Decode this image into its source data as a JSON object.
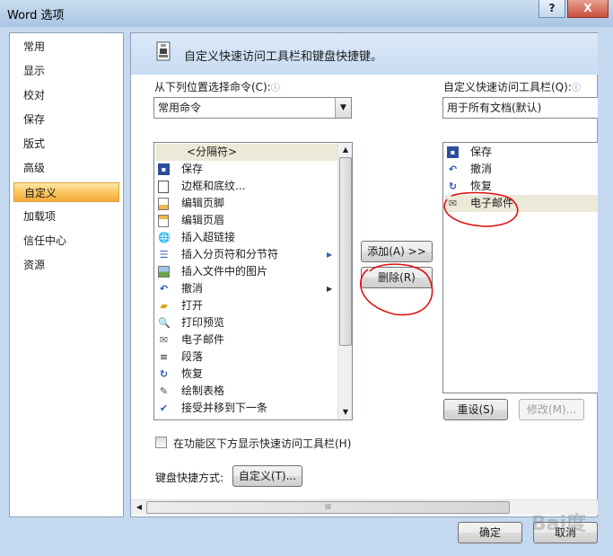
{
  "window": {
    "title": "Word 选项",
    "help_button": "?",
    "close_button": "X"
  },
  "nav": {
    "items": [
      "常用",
      "显示",
      "校对",
      "保存",
      "版式",
      "高级",
      "自定义",
      "加载项",
      "信任中心",
      "资源"
    ],
    "selected": "自定义"
  },
  "header": {
    "title": "自定义快速访问工具栏和键盘快捷键。"
  },
  "left_pane": {
    "label": "从下列位置选择命令(C):",
    "info_icon": "ⓘ",
    "combo_value": "常用命令",
    "commands": [
      {
        "icon": "separator",
        "label": "<分隔符>"
      },
      {
        "icon": "save-icon",
        "label": "保存"
      },
      {
        "icon": "border-icon",
        "label": "边框和底纹..."
      },
      {
        "icon": "footer-icon",
        "label": "编辑页脚"
      },
      {
        "icon": "header-icon",
        "label": "编辑页眉"
      },
      {
        "icon": "hyperlink-icon",
        "label": "插入超链接"
      },
      {
        "icon": "page-break-icon",
        "label": "插入分页符和分节符",
        "submenu": true
      },
      {
        "icon": "picture-icon",
        "label": "插入文件中的图片"
      },
      {
        "icon": "undo-icon",
        "label": "撤消",
        "submenu": true
      },
      {
        "icon": "open-icon",
        "label": "打开"
      },
      {
        "icon": "print-preview-icon",
        "label": "打印预览"
      },
      {
        "icon": "email-icon",
        "label": "电子邮件"
      },
      {
        "icon": "paragraph-icon",
        "label": "段落"
      },
      {
        "icon": "redo-icon",
        "label": "恢复"
      },
      {
        "icon": "draw-table-icon",
        "label": "绘制表格"
      },
      {
        "icon": "accept-change-icon",
        "label": "接受并移到下一条"
      }
    ],
    "show_below_ribbon": "在功能区下方显示快速访问工具栏(H)",
    "shortcut_label": "键盘快捷方式:",
    "shortcut_button": "自定义(T)..."
  },
  "middle": {
    "add_button": "添加(A) >>",
    "remove_button": "删除(R)"
  },
  "right_pane": {
    "label": "自定义快速访问工具栏(Q):",
    "info_icon": "ⓘ",
    "combo_value": "用于所有文档(默认)",
    "items": [
      {
        "icon": "save-icon",
        "label": "保存"
      },
      {
        "icon": "undo-icon",
        "label": "撤消"
      },
      {
        "icon": "redo-icon",
        "label": "恢复"
      },
      {
        "icon": "email-icon",
        "label": "电子邮件",
        "selected": true
      }
    ],
    "reset_button": "重设(S)",
    "modify_button": "修改(M)..."
  },
  "footer": {
    "ok_button": "确定",
    "cancel_button": "取消"
  },
  "hscroll": {
    "thumb_grip": "III"
  },
  "colors": {
    "selected_nav": "#f9c45a",
    "annotation": "#e01010",
    "header_band": "#c8dcf3"
  }
}
